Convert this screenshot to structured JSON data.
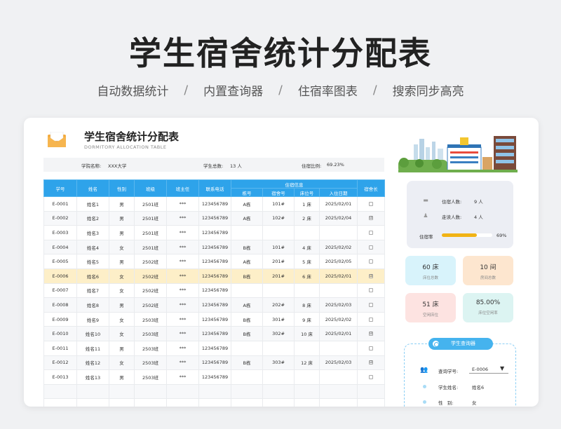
{
  "hero": {
    "title": "学生宿舍统计分配表",
    "features": [
      "自动数据统计",
      "内置查询器",
      "住宿率图表",
      "搜索同步高亮"
    ],
    "separator": "/"
  },
  "sheet": {
    "title": "学生宿舍统计分配表",
    "subtitle": "DORMITORY ALLOCATION TABLE",
    "school_label": "学院名称:",
    "school_value": "XXX大学",
    "total_label": "学生总数:",
    "total_value": "13 人",
    "ratio_label": "住宿比例:",
    "ratio_value": "69.23%"
  },
  "table": {
    "headers": {
      "id": "学号",
      "name": "姓名",
      "gender": "性别",
      "class": "班级",
      "teacher": "班主任",
      "phone": "联系电话",
      "dorm_info": "住宿信息",
      "building": "栋号",
      "room": "宿舍号",
      "bed": "床位号",
      "date": "入住日期",
      "leader": "宿舍长"
    },
    "rows": [
      {
        "id": "E-0001",
        "name": "姓名1",
        "gender": "男",
        "class": "2501班",
        "teacher": "***",
        "phone": "123456789",
        "building": "A栋",
        "room": "101#",
        "bed": "1 床",
        "date": "2025/02/01",
        "leader": ""
      },
      {
        "id": "E-0002",
        "name": "姓名2",
        "gender": "男",
        "class": "2501班",
        "teacher": "***",
        "phone": "123456789",
        "building": "A栋",
        "room": "102#",
        "bed": "2 床",
        "date": "2025/02/04",
        "leader": "☑"
      },
      {
        "id": "E-0003",
        "name": "姓名3",
        "gender": "男",
        "class": "2501班",
        "teacher": "***",
        "phone": "123456789",
        "building": "",
        "room": "",
        "bed": "",
        "date": "",
        "leader": ""
      },
      {
        "id": "E-0004",
        "name": "姓名4",
        "gender": "女",
        "class": "2501班",
        "teacher": "***",
        "phone": "123456789",
        "building": "B栋",
        "room": "101#",
        "bed": "4 床",
        "date": "2025/02/02",
        "leader": ""
      },
      {
        "id": "E-0005",
        "name": "姓名5",
        "gender": "男",
        "class": "2502班",
        "teacher": "***",
        "phone": "123456789",
        "building": "A栋",
        "room": "201#",
        "bed": "5 床",
        "date": "2025/02/05",
        "leader": ""
      },
      {
        "id": "E-0006",
        "name": "姓名6",
        "gender": "女",
        "class": "2502班",
        "teacher": "***",
        "phone": "123456789",
        "building": "B栋",
        "room": "201#",
        "bed": "6 床",
        "date": "2025/02/01",
        "leader": "☑",
        "highlight": true
      },
      {
        "id": "E-0007",
        "name": "姓名7",
        "gender": "女",
        "class": "2502班",
        "teacher": "***",
        "phone": "123456789",
        "building": "",
        "room": "",
        "bed": "",
        "date": "",
        "leader": ""
      },
      {
        "id": "E-0008",
        "name": "姓名8",
        "gender": "男",
        "class": "2502班",
        "teacher": "***",
        "phone": "123456789",
        "building": "A栋",
        "room": "202#",
        "bed": "8 床",
        "date": "2025/02/03",
        "leader": ""
      },
      {
        "id": "E-0009",
        "name": "姓名9",
        "gender": "女",
        "class": "2503班",
        "teacher": "***",
        "phone": "123456789",
        "building": "B栋",
        "room": "301#",
        "bed": "9 床",
        "date": "2025/02/02",
        "leader": ""
      },
      {
        "id": "E-0010",
        "name": "姓名10",
        "gender": "女",
        "class": "2503班",
        "teacher": "***",
        "phone": "123456789",
        "building": "B栋",
        "room": "302#",
        "bed": "10 床",
        "date": "2025/02/01",
        "leader": "☑"
      },
      {
        "id": "E-0011",
        "name": "姓名11",
        "gender": "男",
        "class": "2503班",
        "teacher": "***",
        "phone": "123456789",
        "building": "",
        "room": "",
        "bed": "",
        "date": "",
        "leader": ""
      },
      {
        "id": "E-0012",
        "name": "姓名12",
        "gender": "女",
        "class": "2503班",
        "teacher": "***",
        "phone": "123456789",
        "building": "B栋",
        "room": "303#",
        "bed": "12 床",
        "date": "2025/02/03",
        "leader": "☑"
      },
      {
        "id": "E-0013",
        "name": "姓名13",
        "gender": "男",
        "class": "2503班",
        "teacher": "***",
        "phone": "123456789",
        "building": "",
        "room": "",
        "bed": "",
        "date": "",
        "leader": ""
      },
      {
        "id": "",
        "name": "",
        "gender": "",
        "class": "",
        "teacher": "",
        "phone": "",
        "building": "",
        "room": "",
        "bed": "",
        "date": "",
        "leader": ""
      },
      {
        "id": "",
        "name": "",
        "gender": "",
        "class": "",
        "teacher": "",
        "phone": "",
        "building": "",
        "room": "",
        "bed": "",
        "date": "",
        "leader": ""
      }
    ]
  },
  "stats": {
    "housed_label": "住宿人数:",
    "housed_value": "9 人",
    "day_label": "走读人数:",
    "day_value": "4 人",
    "rate_label": "住宿率",
    "rate_value": "69%",
    "rate_fraction": 0.69
  },
  "tiles": [
    {
      "big": "60 床",
      "small": "床位总数",
      "color": "#d8f3fb"
    },
    {
      "big": "10 间",
      "small": "房间总数",
      "color": "#fde6cf"
    },
    {
      "big": "51 床",
      "small": "空闲床位",
      "color": "#fde3e1"
    },
    {
      "big": "85.00%",
      "small": "床位空闲率",
      "color": "#dcf4f2"
    }
  ],
  "query": {
    "title": "学生查询器",
    "id_label": "查询学号:",
    "id_value": "E-0006",
    "caret": "▼",
    "name_label": "学生姓名:",
    "name_value": "姓名6",
    "gender_label": "性　别:",
    "gender_value": "女"
  },
  "icons": {
    "envelope": "envelope-icon",
    "housed": "bed-icon",
    "day": "person-icon",
    "query": "search-icon",
    "people": "people-icon"
  },
  "colors": {
    "header_blue": "#2ea3ea",
    "highlight_row": "#fdefc8",
    "progress": "#f1b314",
    "query_accent": "#45b3ee"
  }
}
